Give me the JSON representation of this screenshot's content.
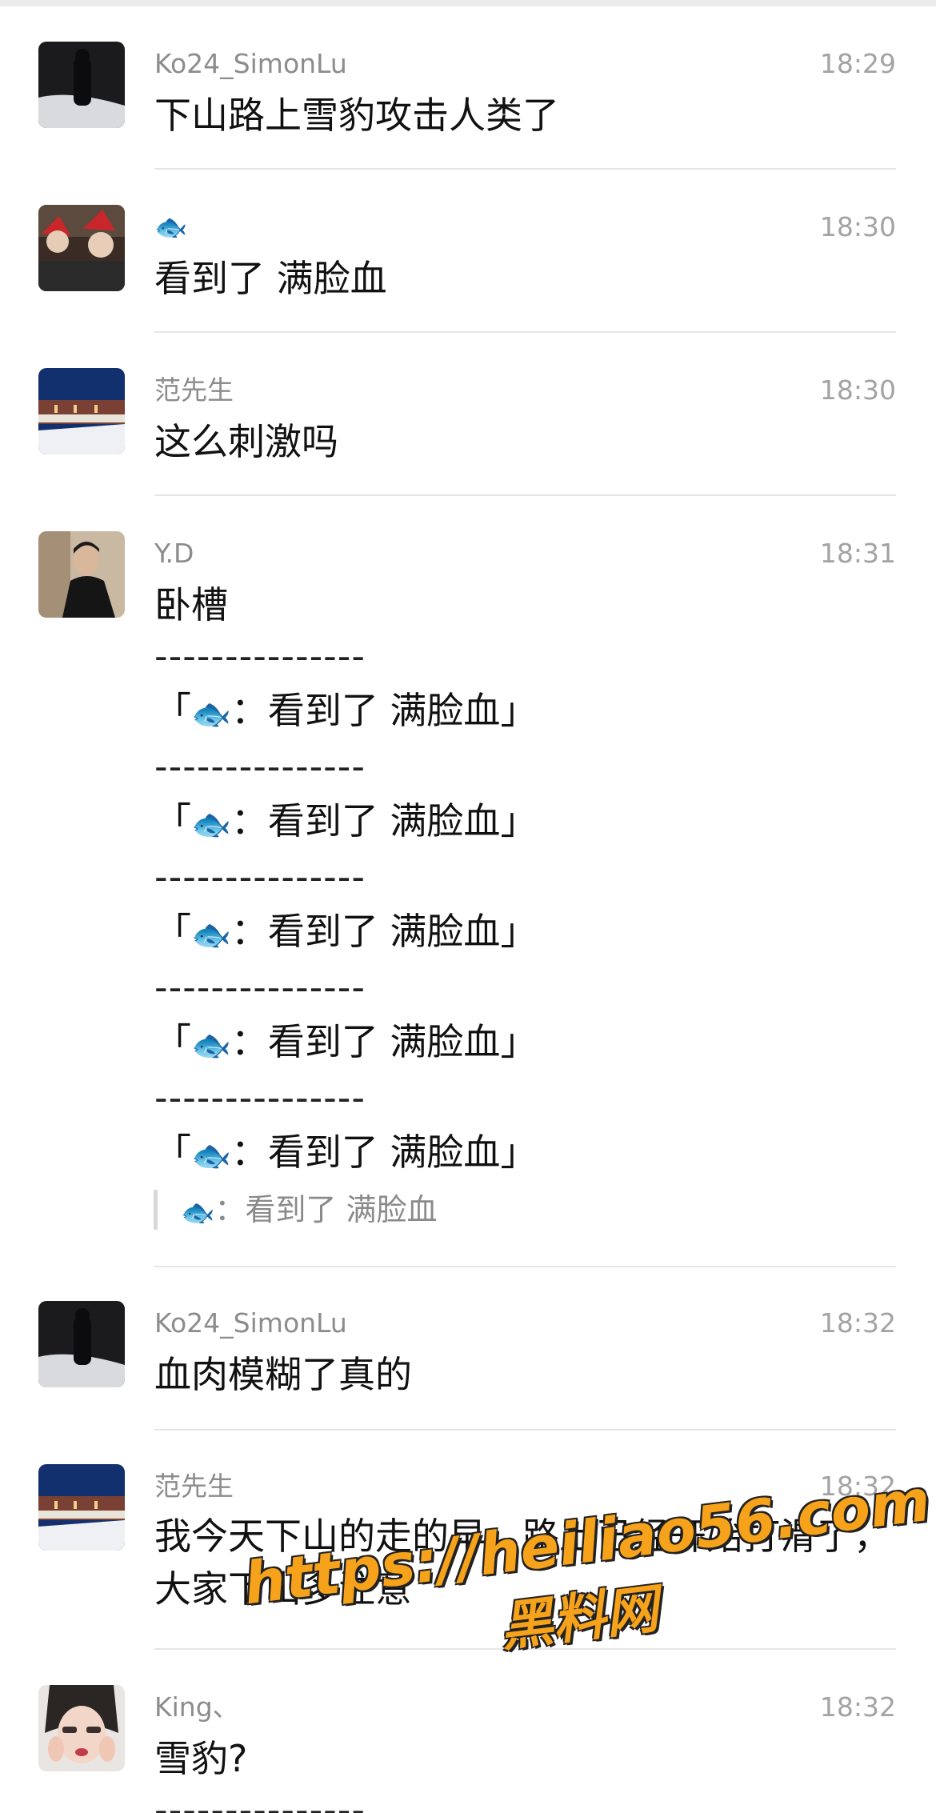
{
  "messages": [
    {
      "name": "Ko24_SimonLu",
      "time": "18:29",
      "text": "下山路上雪豹攻击人类了"
    },
    {
      "name": "🐟",
      "time": "18:30",
      "text": "看到了 满脸血"
    },
    {
      "name": "范先生",
      "time": "18:30",
      "text": "这么刺激吗"
    },
    {
      "name": "Y.D",
      "time": "18:31",
      "text": "卧槽",
      "separator": "---------------",
      "quote_prefix": "「",
      "quote_sender": "🐟",
      "quote_colon": "：",
      "quote_text": "看到了 满脸血",
      "quote_suffix": "」",
      "reply_sender": "🐟",
      "reply_colon": "：",
      "reply_text": "看到了 满脸血"
    },
    {
      "name": "Ko24_SimonLu",
      "time": "18:32",
      "text": "血肉模糊了真的"
    },
    {
      "name": "范先生",
      "time": "18:32",
      "text_line1": "我今天下山的走的早，路上已经开始打滑了，",
      "text_line2": "大家下山多注意"
    },
    {
      "name": "King、",
      "time": "18:32",
      "text": "雪豹?",
      "separator": "---------------"
    }
  ],
  "watermark": {
    "url": "https://heiliao56.com",
    "site": "黑料网"
  }
}
